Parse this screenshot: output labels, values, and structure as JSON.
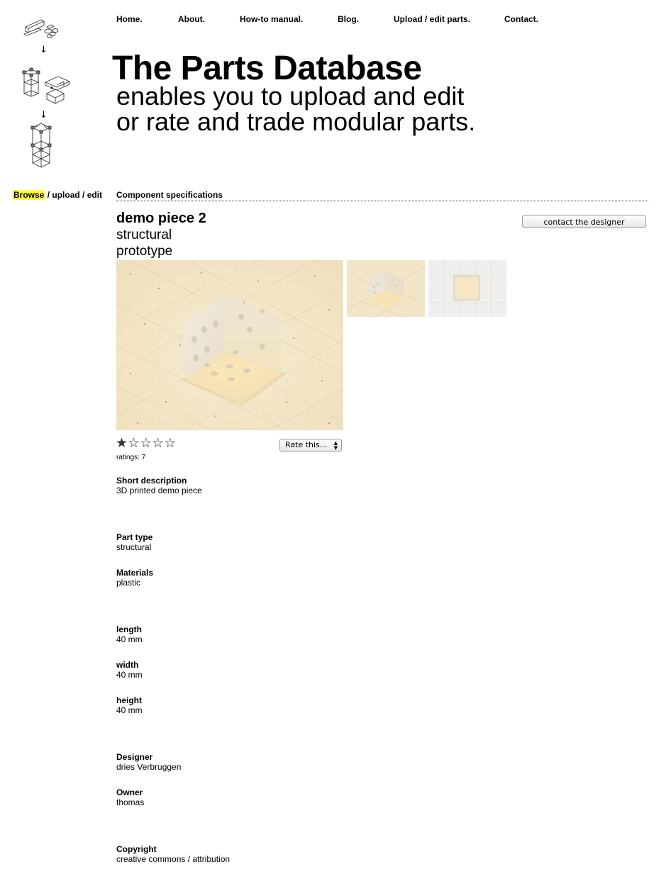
{
  "nav": {
    "items": [
      "Home.",
      "About.",
      "How-to manual.",
      "Blog.",
      "Upload / edit parts.",
      "Contact."
    ]
  },
  "header": {
    "title": "The Parts Database",
    "tagline_line1": "enables you to upload and edit",
    "tagline_line2": "or rate and trade modular parts."
  },
  "sidebar": {
    "browse": "Browse",
    "sep1": " / ",
    "upload": "upload",
    "sep2": " / ",
    "edit": "edit"
  },
  "section": {
    "heading": "Component specifications"
  },
  "part": {
    "name": "demo piece 2",
    "type": "structural",
    "stage": "prototype",
    "contact_button": "contact the designer"
  },
  "rating": {
    "stars_filled": 1,
    "stars_total": 5,
    "filled_glyph": "★",
    "empty_glyph": "☆",
    "count_text": "ratings: 7",
    "select_label": "Rate this..."
  },
  "specs": {
    "short_description_label": "Short description",
    "short_description": "3D printed demo piece",
    "part_type_label": "Part type",
    "part_type": "structural",
    "materials_label": "Materials",
    "materials": "plastic",
    "length_label": "length",
    "length": "40 mm",
    "width_label": "width",
    "width": "40 mm",
    "height_label": "height",
    "height": "40 mm",
    "designer_label": "Designer",
    "designer": "dries Verbruggen",
    "owner_label": "Owner",
    "owner": "thomas",
    "copyright_label": "Copyright",
    "copyright": "creative commons / attribution"
  },
  "logo": {
    "arrow": "↓"
  },
  "colors": {
    "highlight": "#ffff33",
    "image_bg": "#f4e7cc"
  }
}
